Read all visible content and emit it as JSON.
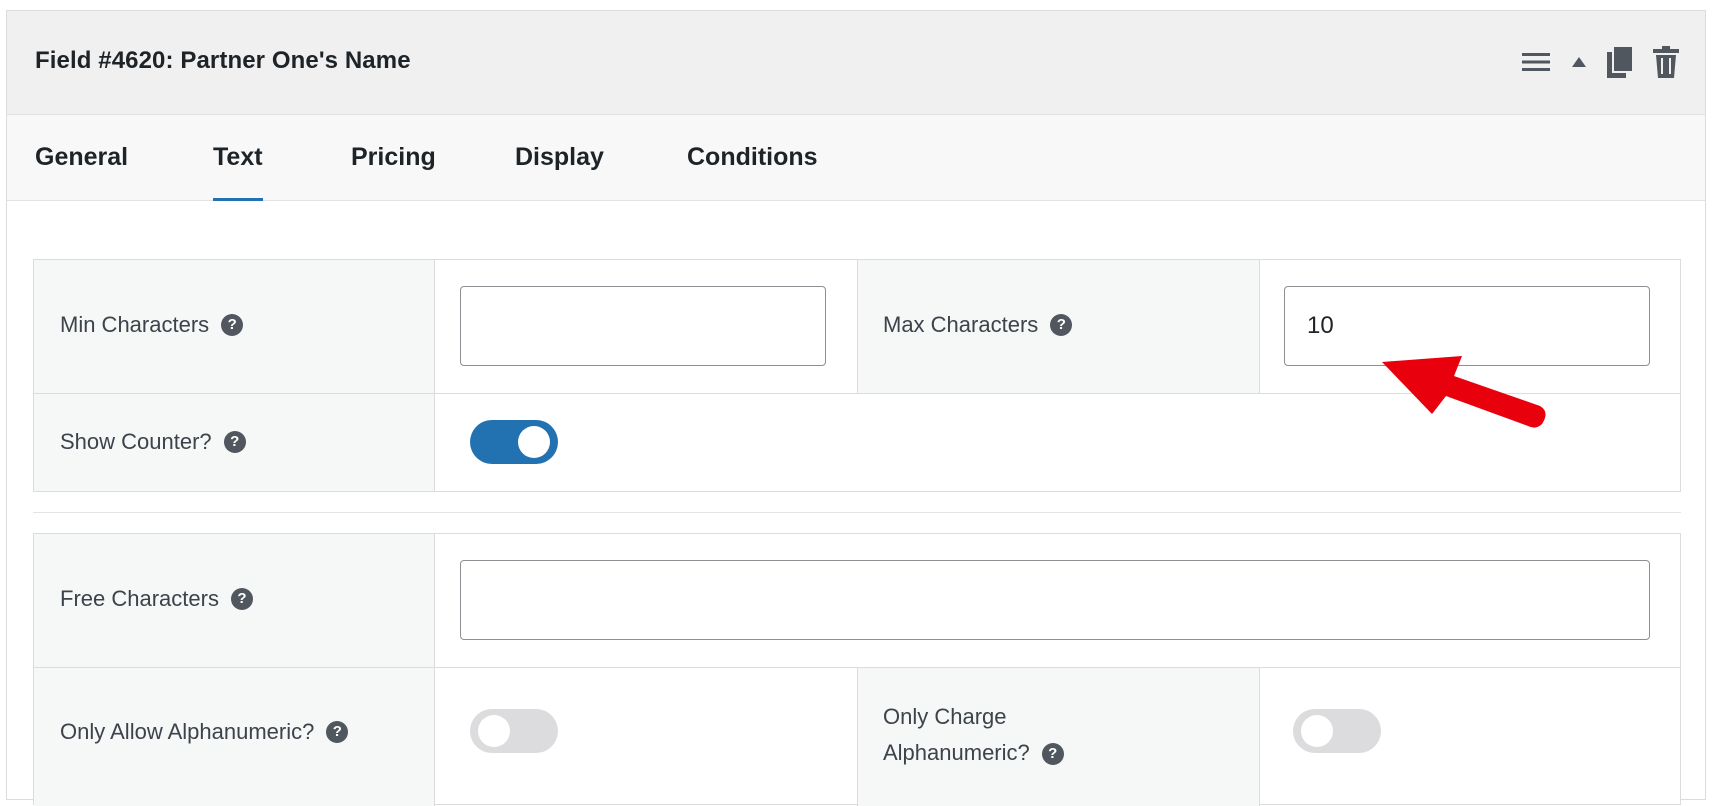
{
  "header": {
    "title": "Field #4620: Partner One's Name",
    "icons": [
      "menu-icon",
      "collapse-arrow-icon",
      "duplicate-icon",
      "trash-icon"
    ]
  },
  "tabs": [
    {
      "label": "General",
      "active": false
    },
    {
      "label": "Text",
      "active": true
    },
    {
      "label": "Pricing",
      "active": false
    },
    {
      "label": "Display",
      "active": false
    },
    {
      "label": "Conditions",
      "active": false
    }
  ],
  "section1": {
    "min_characters": {
      "label": "Min Characters",
      "value": ""
    },
    "max_characters": {
      "label": "Max Characters",
      "value": "10"
    },
    "show_counter": {
      "label": "Show Counter?",
      "enabled": true
    }
  },
  "section2": {
    "free_characters": {
      "label": "Free Characters",
      "value": ""
    },
    "only_allow_alphanumeric": {
      "label": "Only Allow Alphanumeric?",
      "enabled": false
    },
    "only_charge_alphanumeric": {
      "label_line1": "Only Charge",
      "label_line2": "Alphanumeric?",
      "enabled": false
    }
  },
  "help_glyph": "?",
  "colors": {
    "accent": "#2271b1",
    "annotation_arrow": "#e8000d",
    "toggle_off": "#dcdcde"
  }
}
